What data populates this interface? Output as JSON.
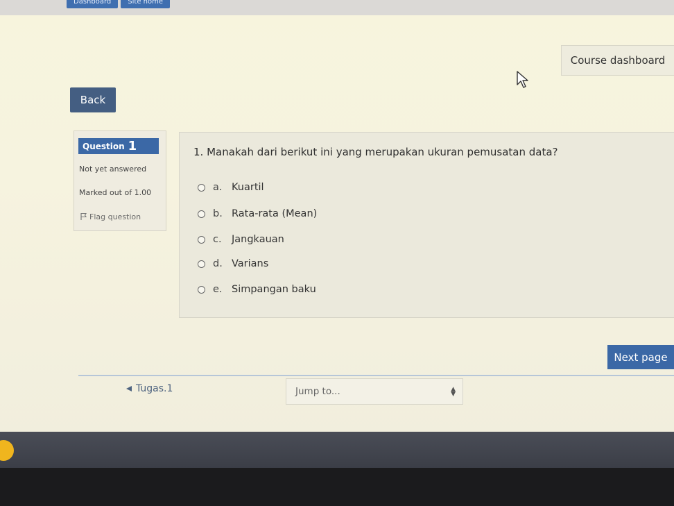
{
  "topbar": {
    "tabs": [
      "Dashboard",
      "Site home"
    ]
  },
  "header": {
    "course_dashboard_label": "Course dashboard"
  },
  "nav": {
    "back_label": "Back"
  },
  "question_info": {
    "label": "Question",
    "number": "1",
    "status": "Not yet answered",
    "marks": "Marked out of 1.00",
    "flag_label": "Flag question"
  },
  "question": {
    "text": "1. Manakah dari berikut ini yang merupakan ukuran pemusatan data?",
    "options": [
      {
        "letter": "a.",
        "text": "Kuartil",
        "selected": false
      },
      {
        "letter": "b.",
        "text": "Rata-rata (Mean)",
        "selected": false
      },
      {
        "letter": "c.",
        "text": "Jangkauan",
        "selected": false
      },
      {
        "letter": "d.",
        "text": "Varians",
        "selected": false
      },
      {
        "letter": "e.",
        "text": "Simpangan baku",
        "selected": false
      }
    ]
  },
  "footer": {
    "next_label": "Next page",
    "prev_link": "Tugas.1",
    "jump_placeholder": "Jump to..."
  },
  "colors": {
    "primary": "#3b68a6",
    "back_button": "#445e82",
    "page_bg": "#f6f3df"
  }
}
